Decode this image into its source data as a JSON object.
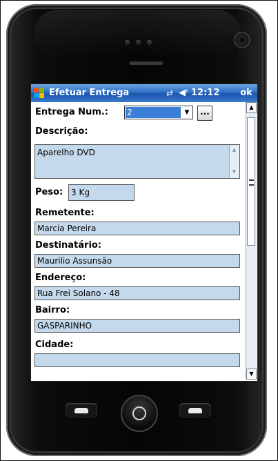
{
  "statusbar": {
    "title": "Efetuar Entrega",
    "time": "12:12",
    "ok_label": "ok",
    "connectivity_icon": "connectivity-icon",
    "volume_icon": "speaker-icon"
  },
  "form": {
    "entrega_num": {
      "label": "Entrega Num.:",
      "value": "2",
      "browse_label": "..."
    },
    "descricao": {
      "label": "Descrição:",
      "value": "Aparelho DVD"
    },
    "peso": {
      "label": "Peso:",
      "value": "3 Kg"
    },
    "remetente": {
      "label": "Remetente:",
      "value": "Marcia Pereira"
    },
    "destinatario": {
      "label": "Destinatário:",
      "value": "Maurilio Assunsão"
    },
    "endereco": {
      "label": "Endereço:",
      "value": "Rua Frei Solano - 48"
    },
    "bairro": {
      "label": "Bairro:",
      "value": "GASPARINHO"
    },
    "cidade": {
      "label": "Cidade:"
    }
  },
  "colors": {
    "titlebar": "#2e6fc6",
    "field_bg": "#c5d9ec",
    "selection": "#3b7fd6",
    "phone_body": "#0a0a0a"
  }
}
